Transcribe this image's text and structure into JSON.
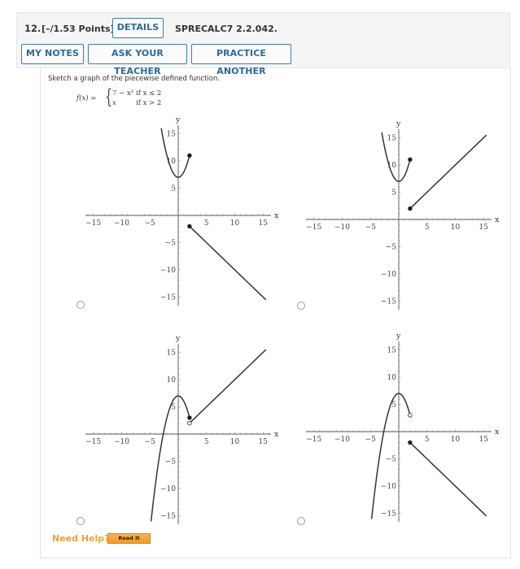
{
  "question": {
    "number": "12.",
    "points": "[–/1.53 Points]",
    "details_label": "DETAILS",
    "assignment_code": "SPRECALC7 2.2.042.",
    "my_notes_label": "MY NOTES",
    "ask_teacher_label": "ASK YOUR TEACHER",
    "practice_another_label": "PRACTICE ANOTHER"
  },
  "prompt": "Sketch a graph of the piecewise defined function.",
  "formula": {
    "lhs": "f(x) =",
    "case1_expr_red": "7",
    "case1_expr_rest": " − x²",
    "case1_cond": "if x ≤ 2",
    "case2_expr": "x",
    "case2_cond": "if x > 2"
  },
  "colors": {
    "button_border": "#3f7fa6",
    "button_text": "#2d6a94",
    "highlight_red": "#c8202a",
    "need_help": "#e8a33c",
    "readit_bg": "#f09a28"
  },
  "help": {
    "need_help_label": "Need Help?",
    "read_it_label": "Read It"
  },
  "chart_data": [
    {
      "type": "line",
      "option": 1,
      "selected": false,
      "xlabel": "x",
      "ylabel": "y",
      "xlim": [
        -15,
        15
      ],
      "ylim": [
        -15,
        15
      ],
      "xticks": [
        -15,
        -10,
        -5,
        5,
        10,
        15
      ],
      "yticks": [
        -15,
        -10,
        -5,
        5,
        10,
        15
      ],
      "pieces": [
        {
          "formula": "x^2 + 7",
          "domain": [
            -3.0,
            2
          ],
          "end_point": {
            "x": 2,
            "y": 11,
            "closed": true
          }
        },
        {
          "formula": "-x",
          "domain": [
            2,
            15.5
          ],
          "start_point": {
            "x": 2,
            "y": -2,
            "closed": true
          }
        }
      ]
    },
    {
      "type": "line",
      "option": 2,
      "selected": false,
      "xlabel": "x",
      "ylabel": "y",
      "xlim": [
        -15,
        15
      ],
      "ylim": [
        -15,
        15
      ],
      "xticks": [
        -15,
        -10,
        -5,
        5,
        10,
        15
      ],
      "yticks": [
        -15,
        -10,
        -5,
        5,
        10,
        15
      ],
      "pieces": [
        {
          "formula": "x^2 + 7",
          "domain": [
            -3.0,
            2
          ],
          "end_point": {
            "x": 2,
            "y": 11,
            "closed": true
          }
        },
        {
          "formula": "x",
          "domain": [
            2,
            15.5
          ],
          "start_point": {
            "x": 2,
            "y": 2,
            "closed": true
          }
        }
      ]
    },
    {
      "type": "line",
      "option": 3,
      "selected": false,
      "xlabel": "x",
      "ylabel": "y",
      "xlim": [
        -15,
        15
      ],
      "ylim": [
        -15,
        15
      ],
      "xticks": [
        -15,
        -10,
        -5,
        5,
        10,
        15
      ],
      "yticks": [
        -15,
        -10,
        -5,
        5,
        10,
        15
      ],
      "pieces": [
        {
          "formula": "7 - x^2",
          "domain": [
            -4.8,
            2
          ],
          "end_point": {
            "x": 2,
            "y": 3,
            "closed": true
          }
        },
        {
          "formula": "x",
          "domain": [
            2,
            15.5
          ],
          "start_point": {
            "x": 2,
            "y": 2,
            "closed": false
          }
        }
      ]
    },
    {
      "type": "line",
      "option": 4,
      "selected": false,
      "xlabel": "x",
      "ylabel": "y",
      "xlim": [
        -15,
        15
      ],
      "ylim": [
        -15,
        15
      ],
      "xticks": [
        -15,
        -10,
        -5,
        5,
        10,
        15
      ],
      "yticks": [
        -15,
        -10,
        -5,
        5,
        10,
        15
      ],
      "pieces": [
        {
          "formula": "7 - x^2",
          "domain": [
            -4.8,
            2
          ],
          "end_point": {
            "x": 2,
            "y": 3,
            "closed": false
          }
        },
        {
          "formula": "-x",
          "domain": [
            2,
            15.5
          ],
          "start_point": {
            "x": 2,
            "y": -2,
            "closed": true
          }
        }
      ]
    }
  ]
}
